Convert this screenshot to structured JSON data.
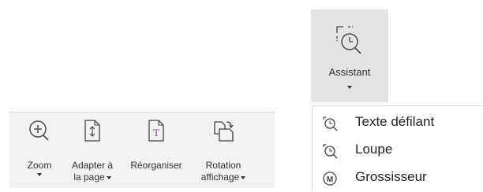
{
  "toolbar": {
    "zoom": {
      "label": "Zoom",
      "icon": "zoom-in-icon"
    },
    "fit_page": {
      "line1": "Adapter à",
      "line2": "la page",
      "icon": "fit-page-icon"
    },
    "reorganize": {
      "label": "Réorganiser",
      "icon": "reorganize-icon"
    },
    "rotate": {
      "line1": "Rotation",
      "line2": "affichage",
      "icon": "rotate-view-icon"
    }
  },
  "assistant": {
    "label": "Assistant",
    "icon": "assistant-icon"
  },
  "menu": {
    "items": [
      {
        "label": "Texte défilant",
        "icon": "scrolling-text-icon"
      },
      {
        "label": "Loupe",
        "icon": "loupe-icon"
      },
      {
        "label": "Grossisseur",
        "icon": "magnifier-m-icon"
      }
    ]
  },
  "colors": {
    "toolbar_bg": "#f2f2f2",
    "assistant_bg": "#e4e4e4",
    "accent_purple": "#8e3d8e"
  }
}
